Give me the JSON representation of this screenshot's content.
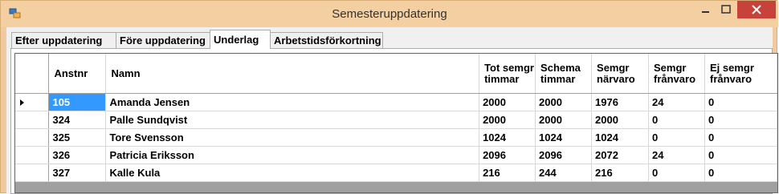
{
  "window": {
    "title": "Semesteruppdatering"
  },
  "tabs": [
    {
      "label": "Efter uppdatering",
      "active": false
    },
    {
      "label": "Före uppdatering",
      "active": false
    },
    {
      "label": "Underlag",
      "active": true
    },
    {
      "label": "Arbetstidsförkortning",
      "active": false
    }
  ],
  "grid": {
    "columns": [
      "Anstnr",
      "Namn",
      "Tot semgr timmar",
      "Schema timmar",
      "Semgr närvaro",
      "Semgr frånvaro",
      "Ej semgr frånvaro"
    ],
    "rows": [
      {
        "anstnr": "105",
        "namn": "Amanda Jensen",
        "tot": "2000",
        "schema": "2000",
        "narvaro": "1976",
        "franvaro": "24",
        "ej": "0"
      },
      {
        "anstnr": "324",
        "namn": "Palle Sundqvist",
        "tot": "2000",
        "schema": "2000",
        "narvaro": "2000",
        "franvaro": "0",
        "ej": "0"
      },
      {
        "anstnr": "325",
        "namn": "Tore Svensson",
        "tot": "1024",
        "schema": "1024",
        "narvaro": "1024",
        "franvaro": "0",
        "ej": "0"
      },
      {
        "anstnr": "326",
        "namn": "Patricia Eriksson",
        "tot": "2096",
        "schema": "2096",
        "narvaro": "2072",
        "franvaro": "24",
        "ej": "0"
      },
      {
        "anstnr": "327",
        "namn": "Kalle Kula",
        "tot": "216",
        "schema": "244",
        "narvaro": "216",
        "franvaro": "0",
        "ej": "0"
      }
    ]
  },
  "colors": {
    "titlebar": "#f3cfa1",
    "selection": "#3399ff",
    "close": "#c7423a"
  }
}
